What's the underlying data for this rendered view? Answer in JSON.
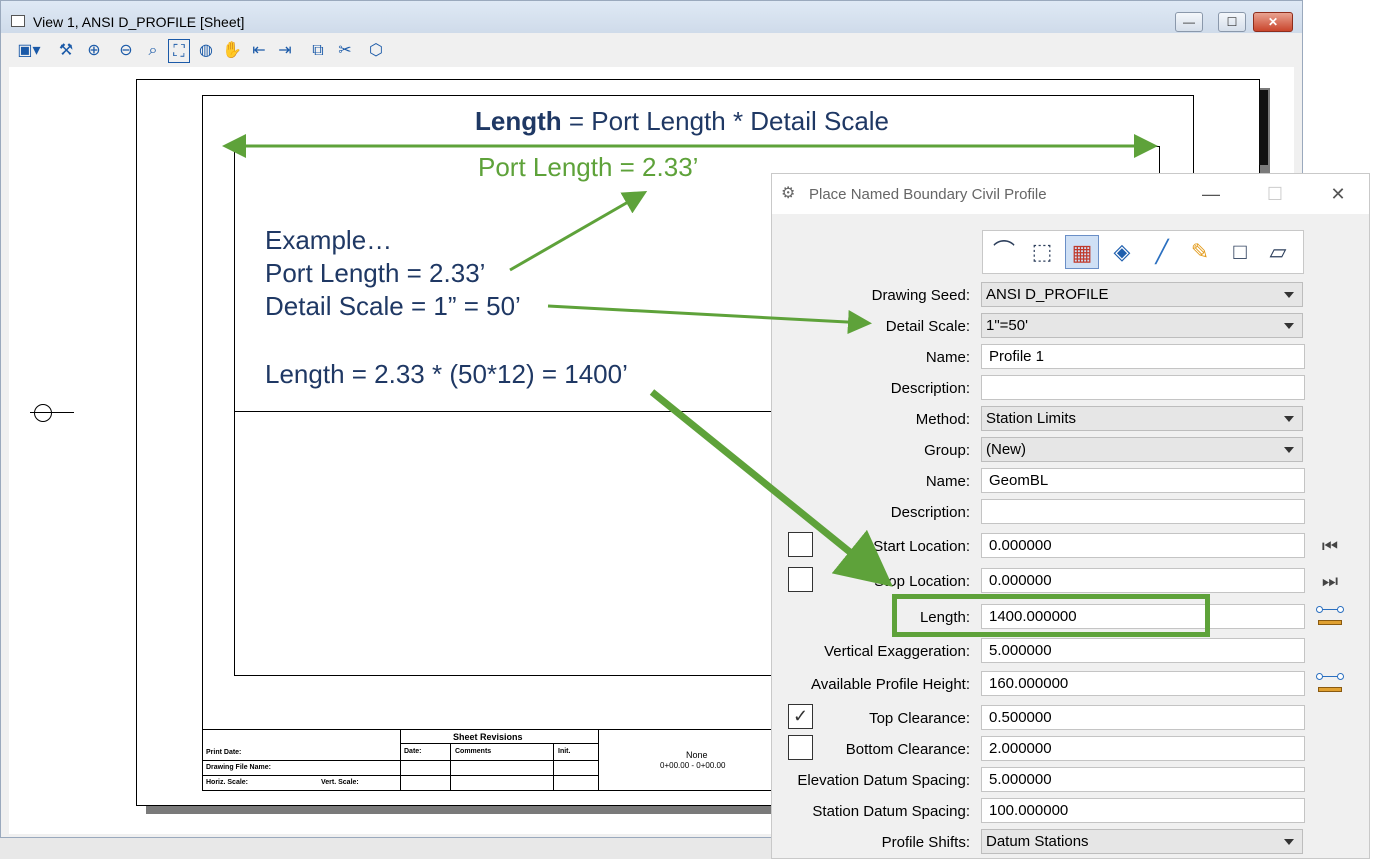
{
  "view_window": {
    "title": "View 1, ANSI D_PROFILE [Sheet]",
    "buttons": {
      "minimize": "—",
      "maximize": "☐",
      "close": "✕"
    },
    "toolbar": [
      "view-attributes-icon",
      "update-view-icon",
      "zoom-in-icon",
      "zoom-out-icon",
      "window-area-icon",
      "fit-view-icon",
      "rotate-view-icon",
      "pan-view-icon",
      "previous-view-icon",
      "next-view-icon",
      "copy-view-icon",
      "clip-volume-icon",
      "view-display-icon"
    ]
  },
  "sheet": {
    "title_block": {
      "revisions_title": "Sheet Revisions",
      "col_date": "Date:",
      "col_comments": "Comments",
      "col_init": "Init.",
      "print_date": "Print Date:",
      "drawing_file_name": "Drawing File Name:",
      "horiz_scale": "Horiz. Scale:",
      "vert_scale": "Vert. Scale:",
      "name": "None",
      "stations": "0+00.00 - 0+00.00"
    }
  },
  "annotations": {
    "formula_bold": "Length",
    "formula_rest": " = Port Length * Detail Scale",
    "port_length_note": "Port Length = 2.33’",
    "example_lines": [
      "Example…",
      "Port Length = 2.33’",
      "Detail Scale = 1” = 50’",
      "Length = 2.33 * (50*12) = 1400’"
    ]
  },
  "dialog": {
    "title": "Place Named Boundary Civil Profile",
    "tools": [
      "civil-profile-icon",
      "select-element-icon",
      "grid-icon",
      "box-3d-icon",
      "line-icon",
      "pencil-icon",
      "square-icon",
      "skewed-square-icon"
    ],
    "fields": {
      "drawing_seed": {
        "label": "Drawing Seed:",
        "value": "ANSI D_PROFILE"
      },
      "detail_scale": {
        "label": "Detail Scale:",
        "value": "1\"=50'"
      },
      "name": {
        "label": "Name:",
        "value": "Profile 1"
      },
      "description": {
        "label": "Description:",
        "value": ""
      },
      "method": {
        "label": "Method:",
        "value": "Station Limits"
      },
      "group": {
        "label": "Group:",
        "value": "(New)"
      },
      "group_name": {
        "label": "Name:",
        "value": "GeomBL"
      },
      "group_description": {
        "label": "Description:",
        "value": ""
      },
      "start_location": {
        "label": "Start Location:",
        "value": "0.000000",
        "checked": false
      },
      "stop_location": {
        "label": "Stop Location:",
        "value": "0.000000",
        "checked": false
      },
      "length": {
        "label": "Length:",
        "value": "1400.000000"
      },
      "vertical_exaggeration": {
        "label": "Vertical Exaggeration:",
        "value": "5.000000"
      },
      "available_profile_height": {
        "label": "Available Profile Height:",
        "value": "160.000000"
      },
      "top_clearance": {
        "label": "Top Clearance:",
        "value": "0.500000",
        "checked": true
      },
      "bottom_clearance": {
        "label": "Bottom Clearance:",
        "value": "2.000000",
        "checked": false
      },
      "elevation_datum_spacing": {
        "label": "Elevation Datum Spacing:",
        "value": "5.000000"
      },
      "station_datum_spacing": {
        "label": "Station Datum Spacing:",
        "value": "100.000000"
      },
      "profile_shifts": {
        "label": "Profile Shifts:",
        "value": "Datum Stations"
      }
    }
  },
  "colors": {
    "annotation_green": "#5ea23a",
    "annotation_navy": "#1f3864"
  }
}
